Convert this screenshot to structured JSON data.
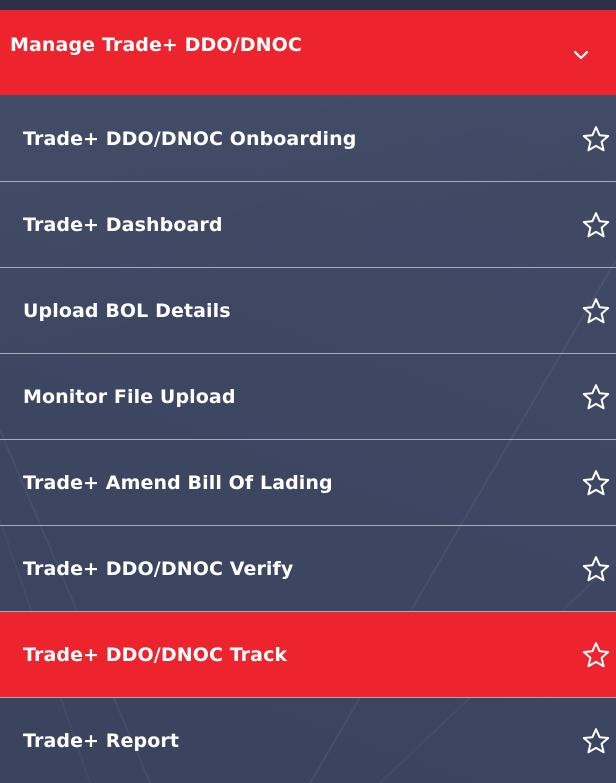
{
  "menu": {
    "header": {
      "title": "Manage Trade+ DDO/DNOC"
    },
    "items": [
      {
        "label": "Trade+ DDO/DNOC Onboarding",
        "active": false
      },
      {
        "label": "Trade+ Dashboard",
        "active": false
      },
      {
        "label": "Upload BOL Details",
        "active": false
      },
      {
        "label": "Monitor File Upload",
        "active": false
      },
      {
        "label": "Trade+ Amend Bill Of Lading",
        "active": false
      },
      {
        "label": "Trade+ DDO/DNOC Verify",
        "active": false
      },
      {
        "label": "Trade+ DDO/DNOC Track",
        "active": true
      },
      {
        "label": "Trade+ Report",
        "active": false
      }
    ]
  },
  "colors": {
    "accent": "#ed242e",
    "background": "#3d4763",
    "divider": "#a5acbd",
    "text": "#ffffff"
  },
  "icons": {
    "header": "chevron-down-icon",
    "item": "star-outline-icon"
  }
}
